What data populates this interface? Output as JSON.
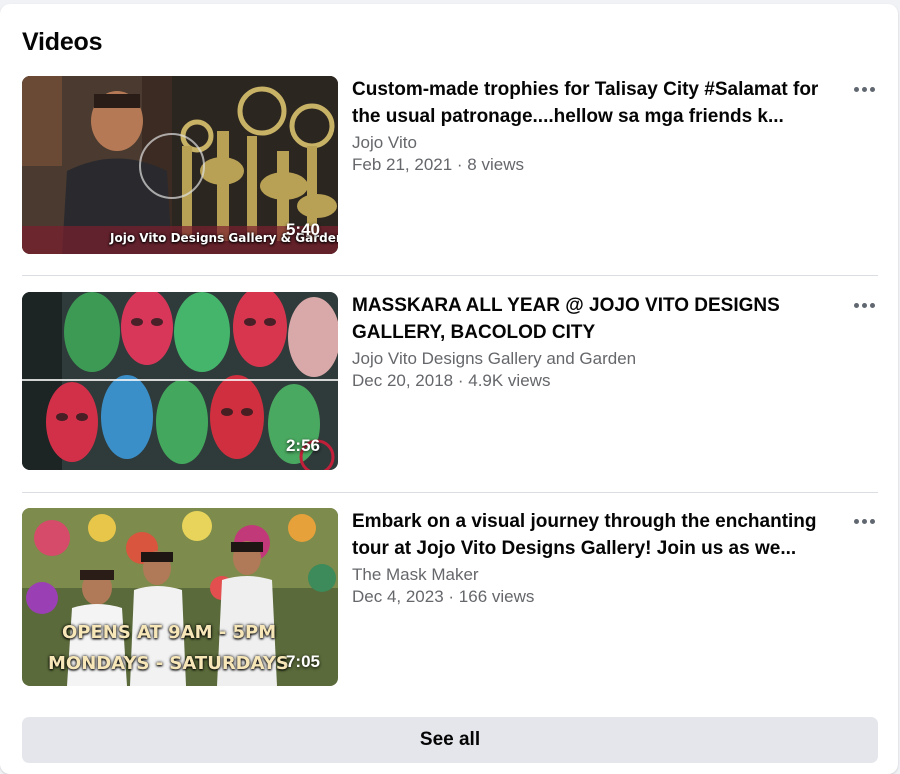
{
  "section": {
    "title": "Videos",
    "see_all_label": "See all"
  },
  "videos": [
    {
      "title": "Custom-made trophies for Talisay City #Salamat for the usual patronage....hellow sa mga friends k...",
      "author": "Jojo Vito",
      "date_views": "Feb 21, 2021 · 8 views",
      "duration": "5:40",
      "overlay_text": "Jojo Vito Designs Gallery & Garden"
    },
    {
      "title": "MASSKARA ALL YEAR @ JOJO VITO DESIGNS GALLERY, BACOLOD CITY",
      "author": "Jojo Vito Designs Gallery and Garden",
      "date_views": "Dec 20, 2018 · 4.9K views",
      "duration": "2:56"
    },
    {
      "title": "Embark on a visual journey through the enchanting tour at Jojo Vito Designs Gallery! Join us as we...",
      "author": "The Mask Maker",
      "date_views": "Dec 4, 2023 · 166 views",
      "duration": "7:05",
      "overlay_line1": "OPENS AT 9AM - 5PM",
      "overlay_line2": "MONDAYS - SATURDAYS"
    }
  ],
  "icons": {
    "more": "more-options-icon"
  },
  "colors": {
    "card_bg": "#ffffff",
    "page_bg": "#f0f2f5",
    "secondary_text": "#65676b",
    "button_bg": "#e4e6eb",
    "divider": "#dadde1"
  }
}
